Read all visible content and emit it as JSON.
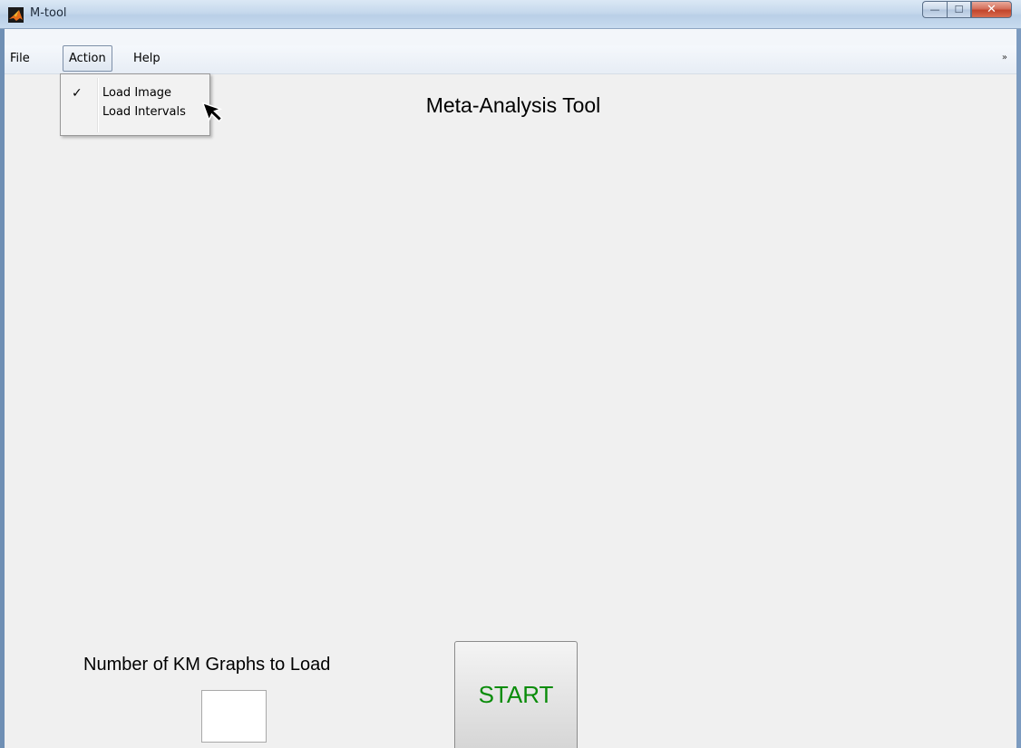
{
  "window": {
    "title": "M-tool",
    "controls": {
      "minimize_glyph": "—",
      "maximize_glyph": "☐",
      "close_glyph": "✕"
    }
  },
  "menubar": {
    "items": [
      {
        "label": "File"
      },
      {
        "label": "Action"
      },
      {
        "label": "Help"
      }
    ],
    "overflow_glyph": "»"
  },
  "action_menu": {
    "items": [
      {
        "label": "Load Image",
        "checked": true,
        "check_glyph": "✓"
      },
      {
        "label": "Load Intervals",
        "checked": false
      }
    ]
  },
  "main": {
    "title": "Meta-Analysis Tool",
    "graphs_count_label": "Number of  KM Graphs to Load",
    "graphs_count_value": "",
    "start_label": "START"
  },
  "colors": {
    "start_text": "#0a8c0a",
    "client_bg": "#f0f0f0"
  },
  "icons": {
    "app": "matlab-logo-icon",
    "cursor": "mouse-pointer-icon"
  }
}
